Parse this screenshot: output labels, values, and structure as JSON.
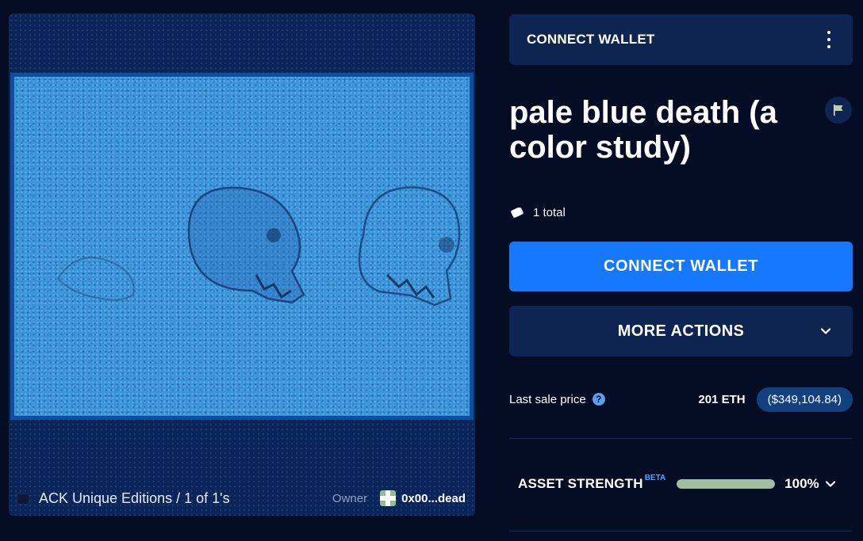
{
  "artwork": {
    "collection_name": "ACK Unique Editions / 1 of 1's",
    "owner_label": "Owner",
    "owner_address": "0x00...dead"
  },
  "header": {
    "connect_wallet_label": "CONNECT WALLET"
  },
  "item": {
    "title": "pale blue death (a color study)",
    "edition_count": "1 total"
  },
  "actions": {
    "connect_wallet_label": "CONNECT WALLET",
    "more_actions_label": "MORE ACTIONS"
  },
  "sale": {
    "label": "Last sale price",
    "eth": "201 ETH",
    "usd": "($349,104.84)"
  },
  "strength": {
    "label": "ASSET STRENGTH",
    "badge": "BETA",
    "value": "100%",
    "fraction": 1.0
  },
  "colors": {
    "background": "#040d24",
    "panel": "#0e2552",
    "accent": "#1677ff",
    "strength_fill": "#9fbe9f"
  },
  "icons": [
    "kebab-menu-icon",
    "flag-icon",
    "ticket-icon",
    "chevron-down-icon",
    "help-icon",
    "collection-icon",
    "owner-avatar"
  ]
}
